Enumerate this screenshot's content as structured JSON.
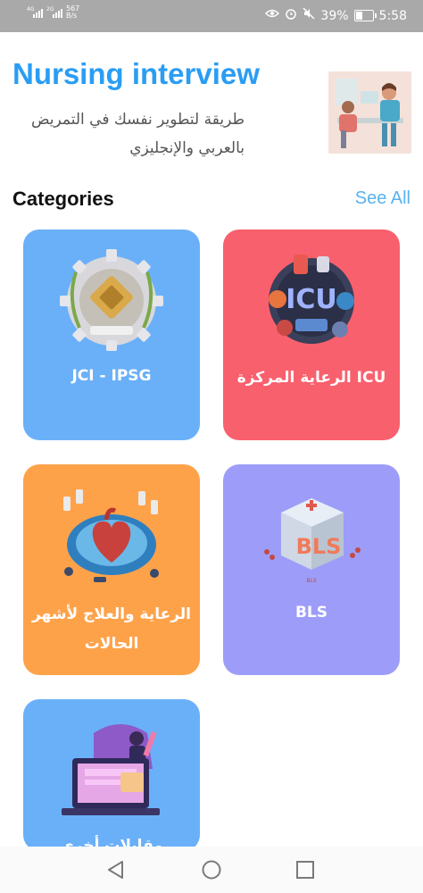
{
  "status_bar": {
    "sig1_tag": "4G",
    "sig2_tag": "2G",
    "speed_value": "567",
    "speed_unit": "B/s",
    "battery": "39%",
    "time": "5:58",
    "battery_level": 0.39
  },
  "header": {
    "title": "Nursing interview",
    "subtitle": "طريقة لتطوير نفسك في التمريض بالعربي والإنجليزي",
    "image_icon": "nurse-interview-illustration"
  },
  "categories": {
    "title": "Categories",
    "see_all": "See All",
    "items": [
      {
        "label": "JCI - IPSG",
        "image_icon": "jci-ipsg-gear-emblem"
      },
      {
        "label": "الرعاية المركزة ICU",
        "image_icon": "icu-equipment-illustration"
      },
      {
        "label": "الرعاية والعلاج لأشهر الحالات",
        "image_icon": "heart-medical-illustration"
      },
      {
        "label": "BLS",
        "image_icon": "bls-cube-illustration"
      },
      {
        "label": "مقابلات أخرى",
        "image_icon": "laptop-interview-illustration"
      }
    ]
  },
  "colors": {
    "title_blue": "#2a9df4",
    "see_all_blue": "#59b2ee",
    "card_blue": "#6ab0f9",
    "card_red": "#f9606d",
    "card_orange": "#fea24a",
    "card_purple": "#9d9df9"
  },
  "nav_bar": {
    "back_icon": "back-triangle-icon",
    "home_icon": "home-circle-icon",
    "recents_icon": "recents-square-icon"
  }
}
